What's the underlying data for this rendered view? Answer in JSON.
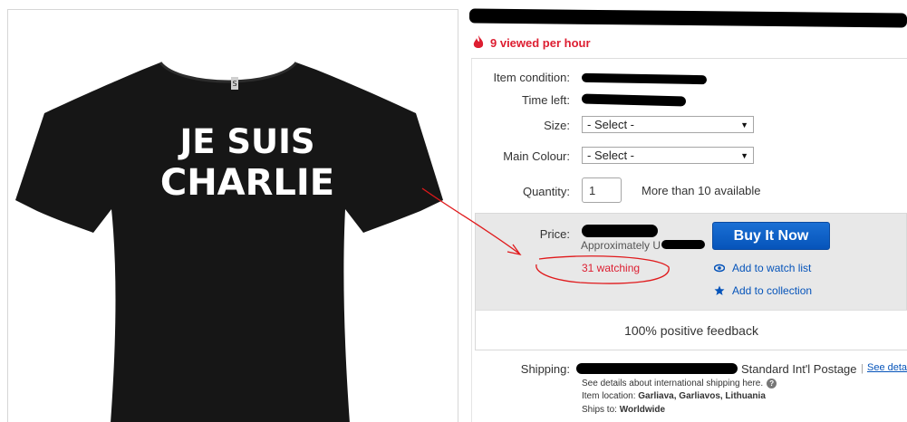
{
  "product_image": {
    "print_line1": "JE SUIS",
    "print_line2": "CHARLIE",
    "label_tag": "S"
  },
  "listing": {
    "hot_text": "9 viewed per hour",
    "item_condition_label": "Item condition:",
    "time_left_label": "Time left:",
    "size_label": "Size:",
    "size_value": "- Select -",
    "main_colour_label": "Main Colour:",
    "main_colour_value": "- Select -",
    "quantity_label": "Quantity:",
    "quantity_value": "1",
    "availability": "More than 10 available"
  },
  "price_box": {
    "price_label": "Price:",
    "approx_text": "Approximately U",
    "buy_label": "Buy It Now",
    "watching_text": "31 watching",
    "watch_list_label": "Add to watch list",
    "collection_label": "Add to collection",
    "feedback_text": "100% positive feedback"
  },
  "shipping": {
    "label": "Shipping:",
    "service": "Standard Int'l Postage",
    "see_details": "See deta",
    "details_note": "See details about international shipping here.",
    "item_location_label": "Item location:",
    "item_location": "Garliava, Garliavos, Lithuania",
    "ships_to_label": "Ships to:",
    "ships_to": "Worldwide"
  },
  "colors": {
    "accent_blue": "#0654ba",
    "alert_red": "#dd1e31",
    "annotation_red": "#e0191b"
  },
  "icons": [
    "flame-icon",
    "chevron-down-icon",
    "eye-icon",
    "star-icon",
    "help-icon"
  ]
}
